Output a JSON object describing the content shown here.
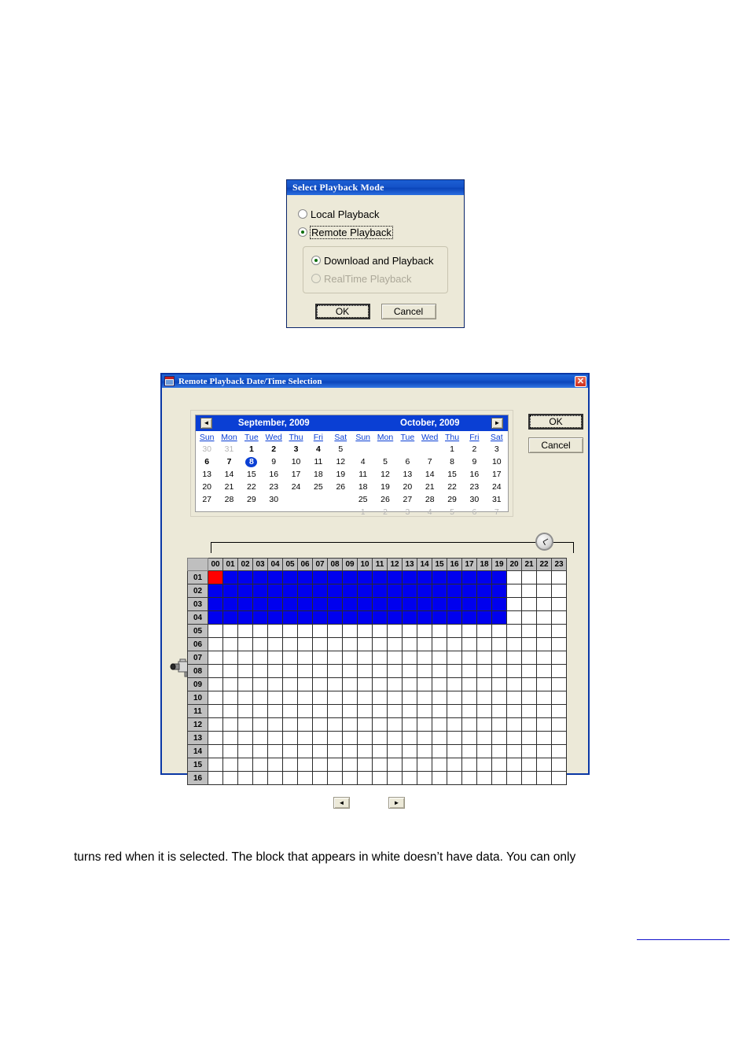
{
  "playback_mode_dialog": {
    "title": "Select Playback Mode",
    "options": [
      {
        "label": "Local Playback",
        "checked": false,
        "disabled": false,
        "focused": false
      },
      {
        "label": "Remote Playback",
        "checked": true,
        "disabled": false,
        "focused": true
      }
    ],
    "sub_options": [
      {
        "label": "Download and Playback",
        "checked": true,
        "disabled": false
      },
      {
        "label": "RealTime Playback",
        "checked": false,
        "disabled": true
      }
    ],
    "ok_label": "OK",
    "cancel_label": "Cancel"
  },
  "datetime_dialog": {
    "title": "Remote Playback Date/Time Selection",
    "title_icon": "calendar-icon",
    "close_label": "✕",
    "ok_label": "OK",
    "cancel_label": "Cancel",
    "clock_icon": "clock-icon",
    "camera_icon": "camera-icon",
    "calendars": [
      {
        "title": "September, 2009",
        "nav": "prev",
        "nav_glyph": "◄",
        "weekdays": [
          "Sun",
          "Mon",
          "Tue",
          "Wed",
          "Thu",
          "Fri",
          "Sat"
        ],
        "weeks": [
          [
            {
              "d": "30",
              "s": "other"
            },
            {
              "d": "31",
              "s": "other"
            },
            {
              "d": "1",
              "s": "bold"
            },
            {
              "d": "2",
              "s": "bold"
            },
            {
              "d": "3",
              "s": "bold"
            },
            {
              "d": "4",
              "s": "bold"
            },
            {
              "d": "5",
              "s": ""
            }
          ],
          [
            {
              "d": "6",
              "s": "bold"
            },
            {
              "d": "7",
              "s": "bold"
            },
            {
              "d": "8",
              "s": "sel"
            },
            {
              "d": "9",
              "s": ""
            },
            {
              "d": "10",
              "s": ""
            },
            {
              "d": "11",
              "s": ""
            },
            {
              "d": "12",
              "s": ""
            }
          ],
          [
            {
              "d": "13",
              "s": ""
            },
            {
              "d": "14",
              "s": ""
            },
            {
              "d": "15",
              "s": ""
            },
            {
              "d": "16",
              "s": ""
            },
            {
              "d": "17",
              "s": ""
            },
            {
              "d": "18",
              "s": ""
            },
            {
              "d": "19",
              "s": ""
            }
          ],
          [
            {
              "d": "20",
              "s": ""
            },
            {
              "d": "21",
              "s": ""
            },
            {
              "d": "22",
              "s": ""
            },
            {
              "d": "23",
              "s": ""
            },
            {
              "d": "24",
              "s": ""
            },
            {
              "d": "25",
              "s": ""
            },
            {
              "d": "26",
              "s": ""
            }
          ],
          [
            {
              "d": "27",
              "s": ""
            },
            {
              "d": "28",
              "s": ""
            },
            {
              "d": "29",
              "s": ""
            },
            {
              "d": "30",
              "s": ""
            },
            {
              "d": "",
              "s": ""
            },
            {
              "d": "",
              "s": ""
            },
            {
              "d": "",
              "s": ""
            }
          ],
          [
            {
              "d": "",
              "s": ""
            },
            {
              "d": "",
              "s": ""
            },
            {
              "d": "",
              "s": ""
            },
            {
              "d": "",
              "s": ""
            },
            {
              "d": "",
              "s": ""
            },
            {
              "d": "",
              "s": ""
            },
            {
              "d": "",
              "s": ""
            }
          ]
        ]
      },
      {
        "title": "October, 2009",
        "nav": "next",
        "nav_glyph": "►",
        "weekdays": [
          "Sun",
          "Mon",
          "Tue",
          "Wed",
          "Thu",
          "Fri",
          "Sat"
        ],
        "weeks": [
          [
            {
              "d": "",
              "s": ""
            },
            {
              "d": "",
              "s": ""
            },
            {
              "d": "",
              "s": ""
            },
            {
              "d": "",
              "s": ""
            },
            {
              "d": "1",
              "s": ""
            },
            {
              "d": "2",
              "s": ""
            },
            {
              "d": "3",
              "s": ""
            }
          ],
          [
            {
              "d": "4",
              "s": ""
            },
            {
              "d": "5",
              "s": ""
            },
            {
              "d": "6",
              "s": ""
            },
            {
              "d": "7",
              "s": ""
            },
            {
              "d": "8",
              "s": ""
            },
            {
              "d": "9",
              "s": ""
            },
            {
              "d": "10",
              "s": ""
            }
          ],
          [
            {
              "d": "11",
              "s": ""
            },
            {
              "d": "12",
              "s": ""
            },
            {
              "d": "13",
              "s": ""
            },
            {
              "d": "14",
              "s": ""
            },
            {
              "d": "15",
              "s": ""
            },
            {
              "d": "16",
              "s": ""
            },
            {
              "d": "17",
              "s": ""
            }
          ],
          [
            {
              "d": "18",
              "s": ""
            },
            {
              "d": "19",
              "s": ""
            },
            {
              "d": "20",
              "s": ""
            },
            {
              "d": "21",
              "s": ""
            },
            {
              "d": "22",
              "s": ""
            },
            {
              "d": "23",
              "s": ""
            },
            {
              "d": "24",
              "s": ""
            }
          ],
          [
            {
              "d": "25",
              "s": ""
            },
            {
              "d": "26",
              "s": ""
            },
            {
              "d": "27",
              "s": ""
            },
            {
              "d": "28",
              "s": ""
            },
            {
              "d": "29",
              "s": ""
            },
            {
              "d": "30",
              "s": ""
            },
            {
              "d": "31",
              "s": ""
            }
          ],
          [
            {
              "d": "1",
              "s": "other"
            },
            {
              "d": "2",
              "s": "other"
            },
            {
              "d": "3",
              "s": "other"
            },
            {
              "d": "4",
              "s": "other"
            },
            {
              "d": "5",
              "s": "other"
            },
            {
              "d": "6",
              "s": "other"
            },
            {
              "d": "7",
              "s": "other"
            }
          ]
        ]
      }
    ],
    "time_grid": {
      "hours": [
        "00",
        "01",
        "02",
        "03",
        "04",
        "05",
        "06",
        "07",
        "08",
        "09",
        "10",
        "11",
        "12",
        "13",
        "14",
        "15",
        "16",
        "17",
        "18",
        "19",
        "20",
        "21",
        "22",
        "23"
      ],
      "channels": [
        "01",
        "02",
        "03",
        "04",
        "05",
        "06",
        "07",
        "08",
        "09",
        "10",
        "11",
        "12",
        "13",
        "14",
        "15",
        "16"
      ],
      "legend": {
        "has_data_color": "#0000ee",
        "selected_color": "#ff0000",
        "no_data_color": "#ffffff"
      },
      "cells": [
        [
          "red",
          "blue",
          "blue",
          "blue",
          "blue",
          "blue",
          "blue",
          "blue",
          "blue",
          "blue",
          "blue",
          "blue",
          "blue",
          "blue",
          "blue",
          "blue",
          "blue",
          "blue",
          "blue",
          "blue",
          "",
          "",
          "",
          ""
        ],
        [
          "blue",
          "blue",
          "blue",
          "blue",
          "blue",
          "blue",
          "blue",
          "blue",
          "blue",
          "blue",
          "blue",
          "blue",
          "blue",
          "blue",
          "blue",
          "blue",
          "blue",
          "blue",
          "blue",
          "blue",
          "",
          "",
          "",
          ""
        ],
        [
          "blue",
          "blue",
          "blue",
          "blue",
          "blue",
          "blue",
          "blue",
          "blue",
          "blue",
          "blue",
          "blue",
          "blue",
          "blue",
          "blue",
          "blue",
          "blue",
          "blue",
          "blue",
          "blue",
          "blue",
          "",
          "",
          "",
          ""
        ],
        [
          "blue",
          "blue",
          "blue",
          "blue",
          "blue",
          "blue",
          "blue",
          "blue",
          "blue",
          "blue",
          "blue",
          "blue",
          "blue",
          "blue",
          "blue",
          "blue",
          "blue",
          "blue",
          "blue",
          "blue",
          "",
          "",
          "",
          ""
        ],
        [
          "",
          "",
          "",
          "",
          "",
          "",
          "",
          "",
          "",
          "",
          "",
          "",
          "",
          "",
          "",
          "",
          "",
          "",
          "",
          "",
          "",
          "",
          "",
          ""
        ],
        [
          "",
          "",
          "",
          "",
          "",
          "",
          "",
          "",
          "",
          "",
          "",
          "",
          "",
          "",
          "",
          "",
          "",
          "",
          "",
          "",
          "",
          "",
          "",
          ""
        ],
        [
          "",
          "",
          "",
          "",
          "",
          "",
          "",
          "",
          "",
          "",
          "",
          "",
          "",
          "",
          "",
          "",
          "",
          "",
          "",
          "",
          "",
          "",
          "",
          ""
        ],
        [
          "",
          "",
          "",
          "",
          "",
          "",
          "",
          "",
          "",
          "",
          "",
          "",
          "",
          "",
          "",
          "",
          "",
          "",
          "",
          "",
          "",
          "",
          "",
          ""
        ],
        [
          "",
          "",
          "",
          "",
          "",
          "",
          "",
          "",
          "",
          "",
          "",
          "",
          "",
          "",
          "",
          "",
          "",
          "",
          "",
          "",
          "",
          "",
          "",
          ""
        ],
        [
          "",
          "",
          "",
          "",
          "",
          "",
          "",
          "",
          "",
          "",
          "",
          "",
          "",
          "",
          "",
          "",
          "",
          "",
          "",
          "",
          "",
          "",
          "",
          ""
        ],
        [
          "",
          "",
          "",
          "",
          "",
          "",
          "",
          "",
          "",
          "",
          "",
          "",
          "",
          "",
          "",
          "",
          "",
          "",
          "",
          "",
          "",
          "",
          "",
          ""
        ],
        [
          "",
          "",
          "",
          "",
          "",
          "",
          "",
          "",
          "",
          "",
          "",
          "",
          "",
          "",
          "",
          "",
          "",
          "",
          "",
          "",
          "",
          "",
          "",
          ""
        ],
        [
          "",
          "",
          "",
          "",
          "",
          "",
          "",
          "",
          "",
          "",
          "",
          "",
          "",
          "",
          "",
          "",
          "",
          "",
          "",
          "",
          "",
          "",
          "",
          ""
        ],
        [
          "",
          "",
          "",
          "",
          "",
          "",
          "",
          "",
          "",
          "",
          "",
          "",
          "",
          "",
          "",
          "",
          "",
          "",
          "",
          "",
          "",
          "",
          "",
          ""
        ],
        [
          "",
          "",
          "",
          "",
          "",
          "",
          "",
          "",
          "",
          "",
          "",
          "",
          "",
          "",
          "",
          "",
          "",
          "",
          "",
          "",
          "",
          "",
          "",
          ""
        ],
        [
          "",
          "",
          "",
          "",
          "",
          "",
          "",
          "",
          "",
          "",
          "",
          "",
          "",
          "",
          "",
          "",
          "",
          "",
          "",
          "",
          "",
          "",
          "",
          ""
        ]
      ]
    }
  },
  "page": {
    "nav_prev_glyph": "◄",
    "nav_next_glyph": "►",
    "paragraph": "turns red when it is selected. The block that appears in white doesn’t have data. You can only"
  }
}
